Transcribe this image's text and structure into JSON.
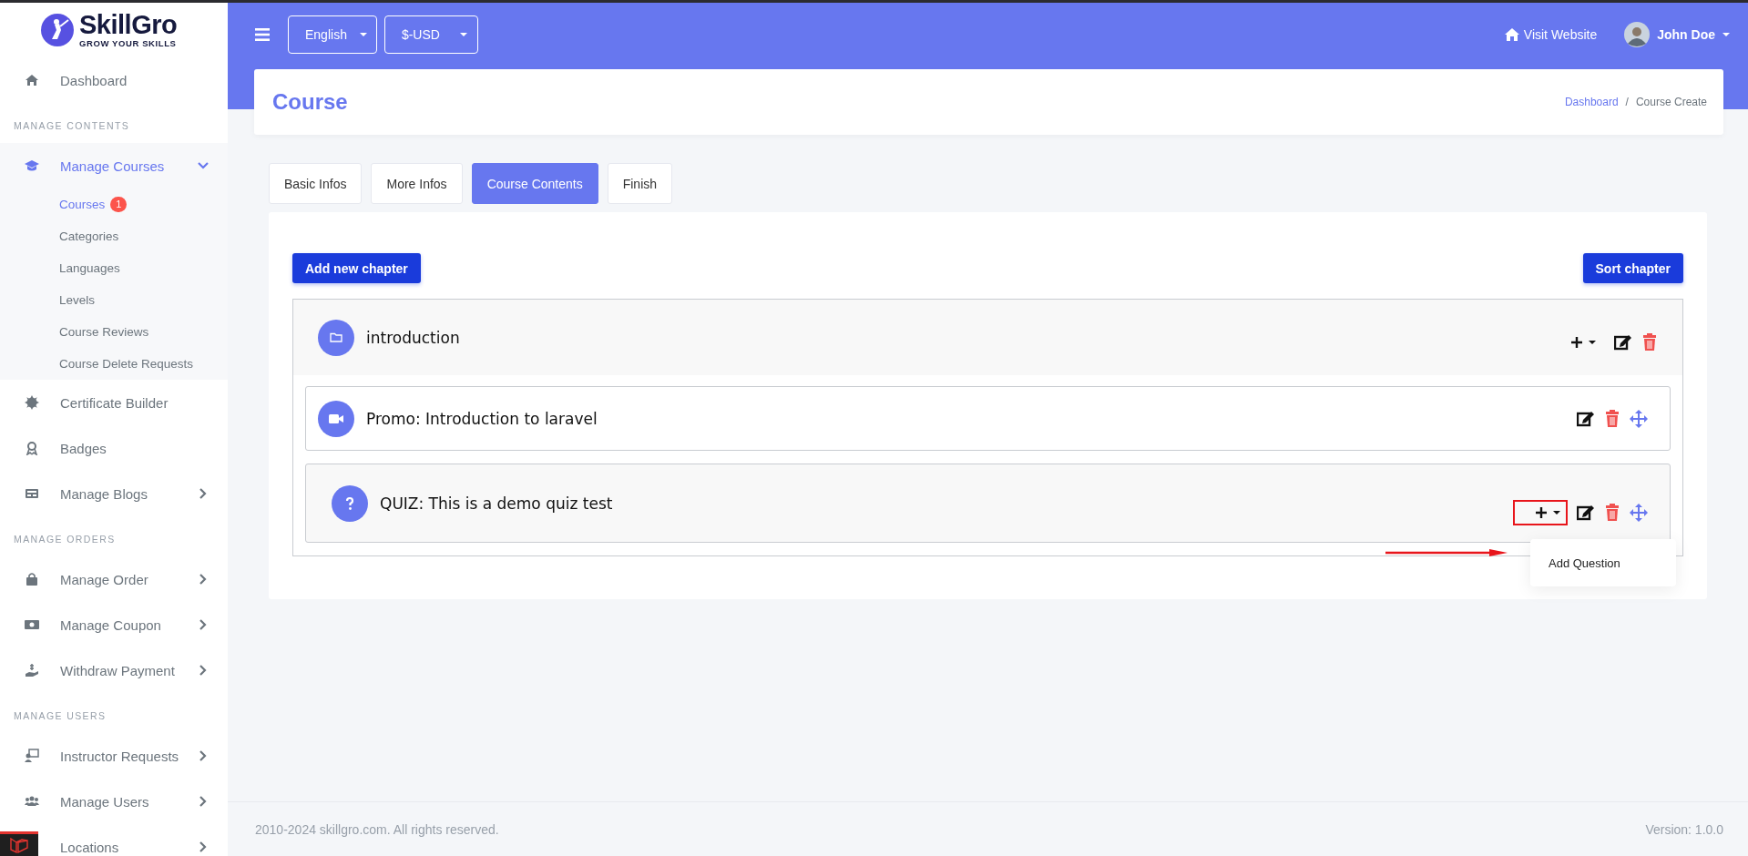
{
  "sidebar": {
    "logo": {
      "name": "SkillGro",
      "tagline": "GROW YOUR SKILLS"
    },
    "sections": [
      {
        "items": [
          {
            "label": "Dashboard",
            "kind": "link"
          }
        ]
      },
      {
        "heading": "MANAGE CONTENTS",
        "items": [
          {
            "label": "Manage Courses",
            "kind": "group",
            "expanded": true,
            "children": [
              {
                "label": "Courses",
                "badge": "1",
                "selected": true
              },
              {
                "label": "Categories",
                "selected": false
              },
              {
                "label": "Languages",
                "selected": false
              },
              {
                "label": "Levels",
                "selected": false
              },
              {
                "label": "Course Reviews",
                "selected": false
              },
              {
                "label": "Course Delete Requests",
                "selected": false
              }
            ]
          },
          {
            "label": "Certificate Builder",
            "kind": "link"
          },
          {
            "label": "Badges",
            "kind": "link"
          },
          {
            "label": "Manage Blogs",
            "kind": "group",
            "expanded": false
          }
        ]
      },
      {
        "heading": "MANAGE ORDERS",
        "items": [
          {
            "label": "Manage Order",
            "kind": "group",
            "expanded": false
          },
          {
            "label": "Manage Coupon",
            "kind": "group",
            "expanded": false
          },
          {
            "label": "Withdraw Payment",
            "kind": "group",
            "expanded": false
          }
        ]
      },
      {
        "heading": "MANAGE USERS",
        "items": [
          {
            "label": "Instructor Requests",
            "kind": "group",
            "expanded": false
          },
          {
            "label": "Manage Users",
            "kind": "group",
            "expanded": false
          },
          {
            "label": "Locations",
            "kind": "group",
            "expanded": false
          }
        ]
      }
    ]
  },
  "topbar": {
    "language": "English",
    "currency": "$-USD",
    "visit_link": "Visit Website",
    "user": "John Doe"
  },
  "page_header": {
    "title": "Course",
    "breadcrumb_separator": "/",
    "breadcrumb": [
      {
        "label": "Dashboard",
        "current": false
      },
      {
        "label": "Course Create",
        "current": true
      }
    ]
  },
  "tabs": [
    {
      "label": "Basic Infos",
      "selected": false
    },
    {
      "label": "More Infos",
      "selected": false
    },
    {
      "label": "Course Contents",
      "selected": true
    },
    {
      "label": "Finish",
      "selected": false
    }
  ],
  "add_chapter_button": "Add new chapter",
  "sort_chapter_button": "Sort chapter",
  "chapters": [
    {
      "title": "introduction",
      "items": [
        {
          "kind": "video",
          "title": "Promo: Introduction to laravel"
        },
        {
          "kind": "quiz",
          "title": "QUIZ: This is a demo quiz test",
          "highlighted": true,
          "menu": [
            "Add Question"
          ]
        }
      ]
    }
  ],
  "footer": {
    "copyright": "2010-2024 skillgro.com. All rights reserved.",
    "version": "Version: 1.0.0"
  }
}
